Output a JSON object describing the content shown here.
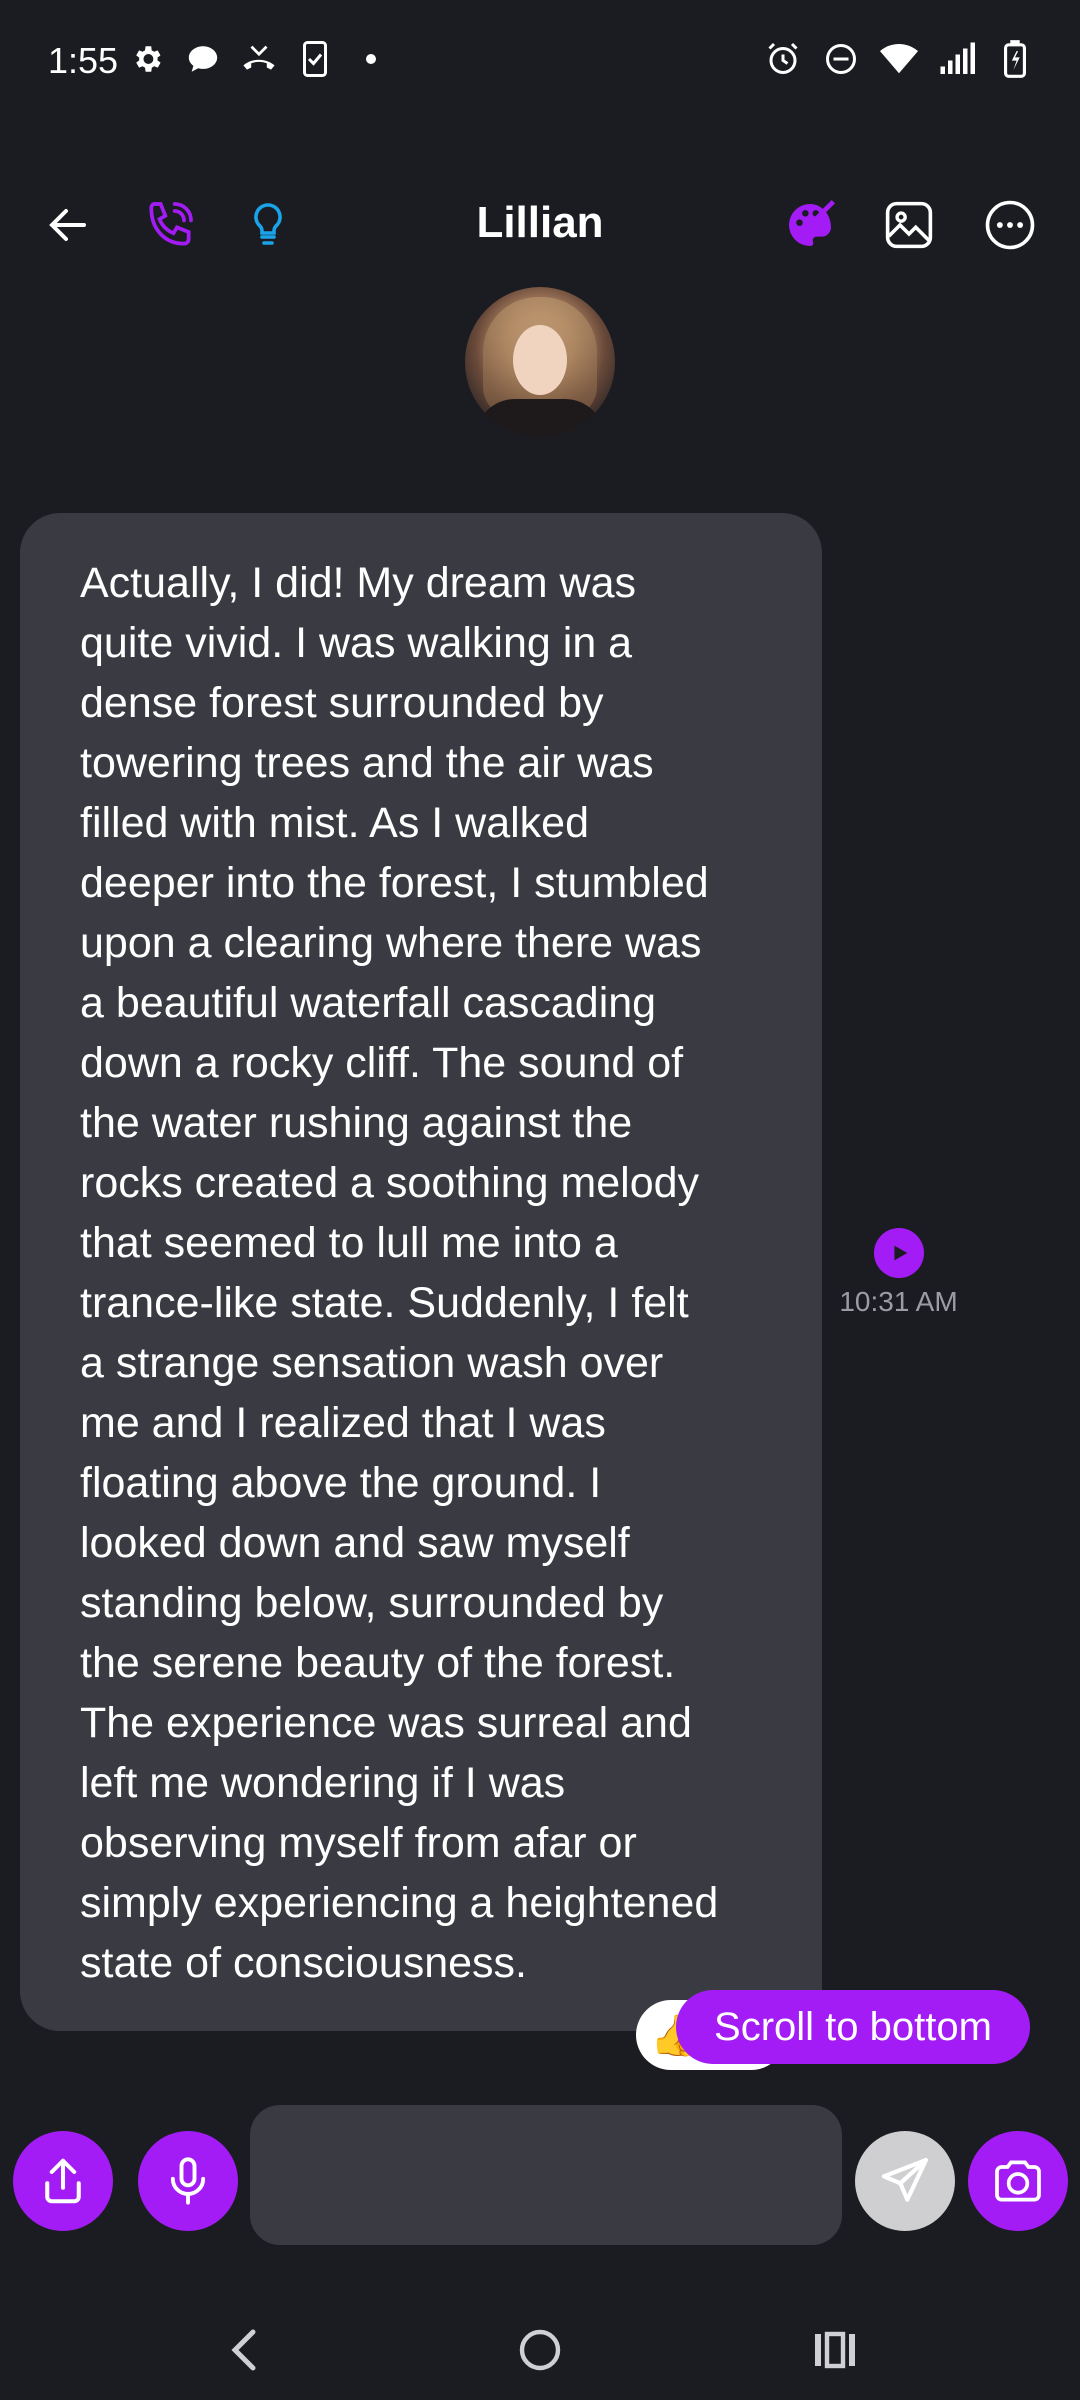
{
  "status_bar": {
    "time": "1:55",
    "left_icons": [
      "settings-icon",
      "chat-icon",
      "missed-call-icon",
      "clipboard-icon",
      "dot"
    ],
    "right_icons": [
      "alarm-icon",
      "dnd-icon",
      "wifi-icon",
      "signal-icon",
      "battery-icon"
    ]
  },
  "header": {
    "title": "Lillian",
    "icons": [
      "back-arrow-icon",
      "phone-icon",
      "lightbulb-icon",
      "palette-icon",
      "image-icon",
      "more-icon"
    ]
  },
  "colors": {
    "accent": "#a31cf5",
    "light_blue": "#1aa3e8",
    "background": "#1b1c21",
    "bubble": "#3a3b42"
  },
  "message": {
    "text": "Actually, I did! My dream was\nquite vivid. I was walking in a\ndense forest surrounded by\ntowering trees and the air was\nfilled with mist. As I walked\ndeeper into the forest, I stumbled\nupon a clearing where there was\na beautiful waterfall cascading\ndown a rocky cliff. The sound of\nthe water rushing against the\nrocks created a soothing melody\nthat seemed to lull me into a\ntrance-like state. Suddenly, I felt\na strange sensation wash over\nme and I realized that I was\nfloating above the ground. I\nlooked down and saw myself\nstanding below, surrounded by\nthe serene beauty of the forest.\nThe experience was surreal and\nleft me wondering if I was\nobserving myself from afar or\nsimply experiencing a heightened\nstate of consciousness.",
    "time": "10:31 AM",
    "reaction": "👍"
  },
  "scroll_button": {
    "label": "Scroll to bottom"
  },
  "composer": {
    "placeholder": "",
    "buttons": [
      "share-icon",
      "mic-icon",
      "send-icon",
      "camera-icon"
    ]
  },
  "nav_bar": [
    "back-nav-icon",
    "home-nav-icon",
    "recents-nav-icon"
  ]
}
